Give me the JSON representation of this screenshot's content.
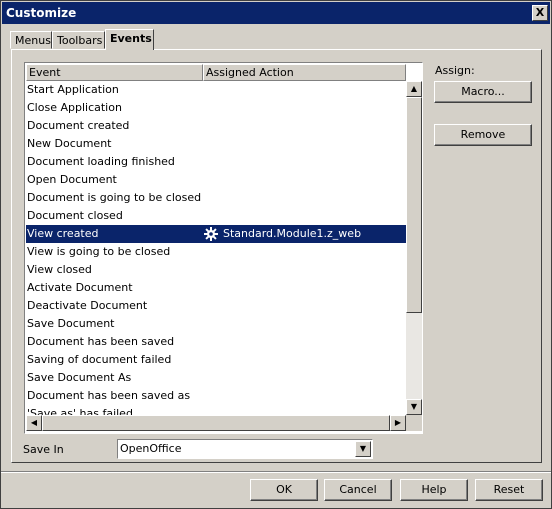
{
  "window": {
    "title": "Customize",
    "close_glyph": "X"
  },
  "tabs": [
    {
      "label": "Menus"
    },
    {
      "label": "Toolbars"
    },
    {
      "label": "Events",
      "active": true
    }
  ],
  "events_list": {
    "col_event": "Event",
    "col_action": "Assigned Action",
    "rows": [
      {
        "event": "Start Application",
        "action": ""
      },
      {
        "event": "Close Application",
        "action": ""
      },
      {
        "event": "Document created",
        "action": ""
      },
      {
        "event": "New Document",
        "action": ""
      },
      {
        "event": "Document loading finished",
        "action": ""
      },
      {
        "event": "Open Document",
        "action": ""
      },
      {
        "event": "Document is going to be closed",
        "action": ""
      },
      {
        "event": "Document closed",
        "action": ""
      },
      {
        "event": "View created",
        "action": "Standard.Module1.z_web",
        "selected": true,
        "icon": "gear-icon"
      },
      {
        "event": "View is going to be closed",
        "action": ""
      },
      {
        "event": "View closed",
        "action": ""
      },
      {
        "event": "Activate Document",
        "action": ""
      },
      {
        "event": "Deactivate Document",
        "action": ""
      },
      {
        "event": "Save Document",
        "action": ""
      },
      {
        "event": "Document has been saved",
        "action": ""
      },
      {
        "event": "Saving of document failed",
        "action": ""
      },
      {
        "event": "Save Document As",
        "action": ""
      },
      {
        "event": "Document has been saved as",
        "action": ""
      },
      {
        "event": "'Save as' has failed",
        "action": ""
      }
    ]
  },
  "assign": {
    "label": "Assign:",
    "macro_button": "Macro...",
    "remove_button": "Remove"
  },
  "save_in": {
    "label": "Save In",
    "value": "OpenOffice"
  },
  "footer": {
    "ok": "OK",
    "cancel": "Cancel",
    "help": "Help",
    "reset": "Reset"
  },
  "colors": {
    "selection": "#0a246a",
    "face": "#d4d0c8",
    "title_bar": "#0a246a"
  }
}
